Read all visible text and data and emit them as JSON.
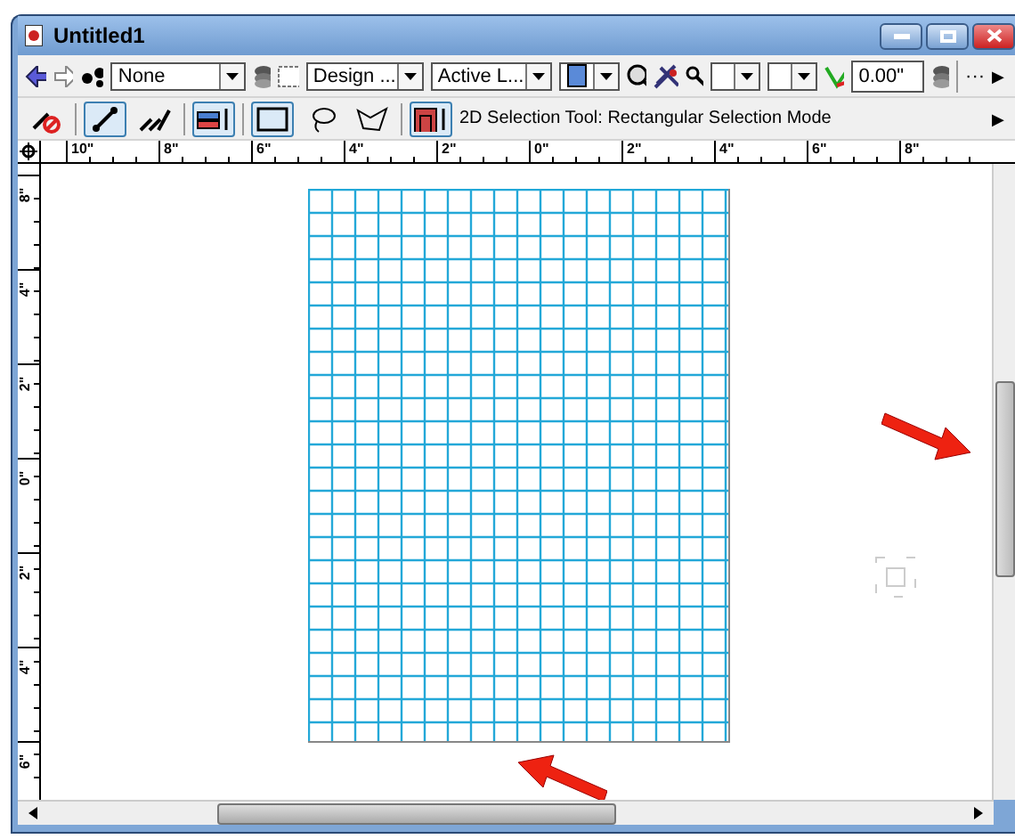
{
  "window": {
    "title": "Untitled1"
  },
  "view_bar": {
    "class_dropdown": {
      "value": "None"
    },
    "layer_dropdown": {
      "value": "Design ..."
    },
    "layer_options_dropdown": {
      "value": "Active L..."
    },
    "rotation_field": {
      "value": "0.00\""
    },
    "overflow": "···",
    "more": "▶"
  },
  "mode_bar": {
    "tools": [
      {
        "kind": "no-snap",
        "selected": false
      },
      {
        "kind": "line",
        "selected": true
      },
      {
        "kind": "multi-line",
        "selected": false
      },
      {
        "kind": "transform",
        "selected": true
      },
      {
        "kind": "rect",
        "selected": true
      },
      {
        "kind": "lasso",
        "selected": false
      },
      {
        "kind": "polygon",
        "selected": false
      },
      {
        "kind": "sel-mode",
        "selected": true
      }
    ],
    "mode_text": "2D Selection Tool: Rectangular Selection Mode",
    "more": "▶"
  },
  "ruler_h": {
    "labels": [
      "10\"",
      "8\"",
      "6\"",
      "4\"",
      "2\"",
      "0\"",
      "2\"",
      "4\"",
      "6\"",
      "8\""
    ]
  },
  "ruler_v": {
    "labels": [
      "8\"",
      "4\"",
      "2\"",
      "0\"",
      "2\"",
      "4\"",
      "6\""
    ]
  }
}
